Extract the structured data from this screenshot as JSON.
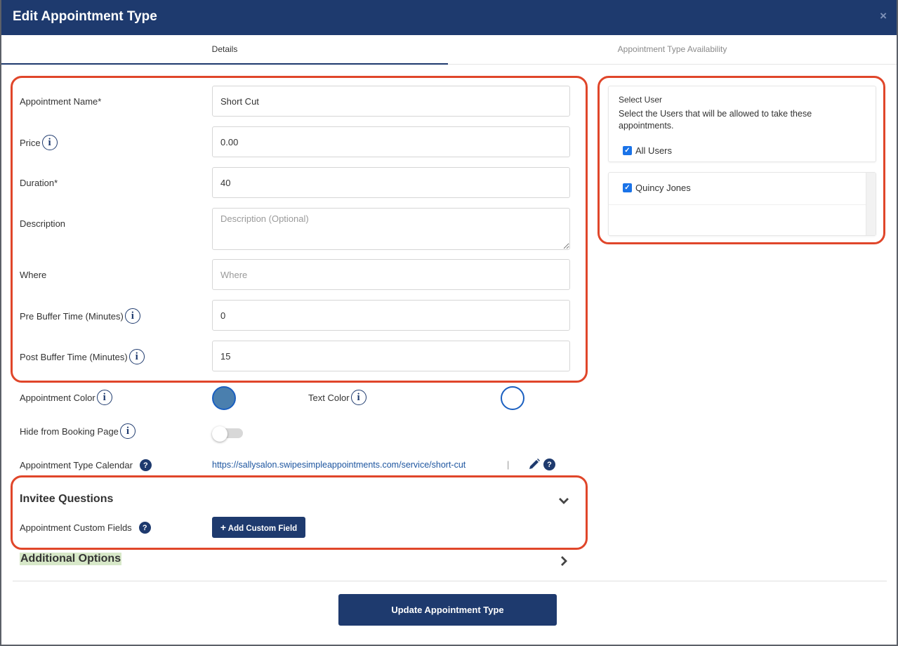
{
  "header": {
    "title": "Edit Appointment Type",
    "close": "×"
  },
  "tabs": [
    {
      "label": "Details"
    },
    {
      "label": "Appointment Type Availability"
    }
  ],
  "form": {
    "name_label": "Appointment Name*",
    "name_value": "Short Cut",
    "price_label": "Price",
    "price_value": "0.00",
    "duration_label": "Duration*",
    "duration_value": "40",
    "description_label": "Description",
    "description_placeholder": "Description (Optional)",
    "where_label": "Where",
    "where_placeholder": "Where",
    "pre_buffer_label": "Pre Buffer Time (Minutes)",
    "pre_buffer_value": "0",
    "post_buffer_label": "Post Buffer Time (Minutes)",
    "post_buffer_value": "15",
    "appointment_color_label": "Appointment Color",
    "text_color_label": "Text Color",
    "hide_label": "Hide from Booking Page",
    "calendar_label": "Appointment Type Calendar",
    "calendar_url": "https://sallysalon.swipesimpleappointments.com/service/short-cut",
    "separator": "|"
  },
  "icons": {
    "info": "i",
    "help": "?",
    "check": "✓",
    "plus": "+"
  },
  "colors": {
    "brand": "#1e3a6e",
    "appointment_color": "#4a7fae",
    "text_color": "#ffffff",
    "highlight": "#e0462a"
  },
  "invitee": {
    "title": "Invitee Questions",
    "custom_fields_label": "Appointment Custom Fields",
    "add_button": "Add Custom Field"
  },
  "additional": {
    "title": "Additional Options"
  },
  "select_user": {
    "title": "Select User",
    "description": "Select the Users that will be allowed to take these appointments.",
    "all_users": "All Users",
    "users": [
      "Quincy Jones"
    ]
  },
  "footer": {
    "submit": "Update Appointment Type"
  }
}
